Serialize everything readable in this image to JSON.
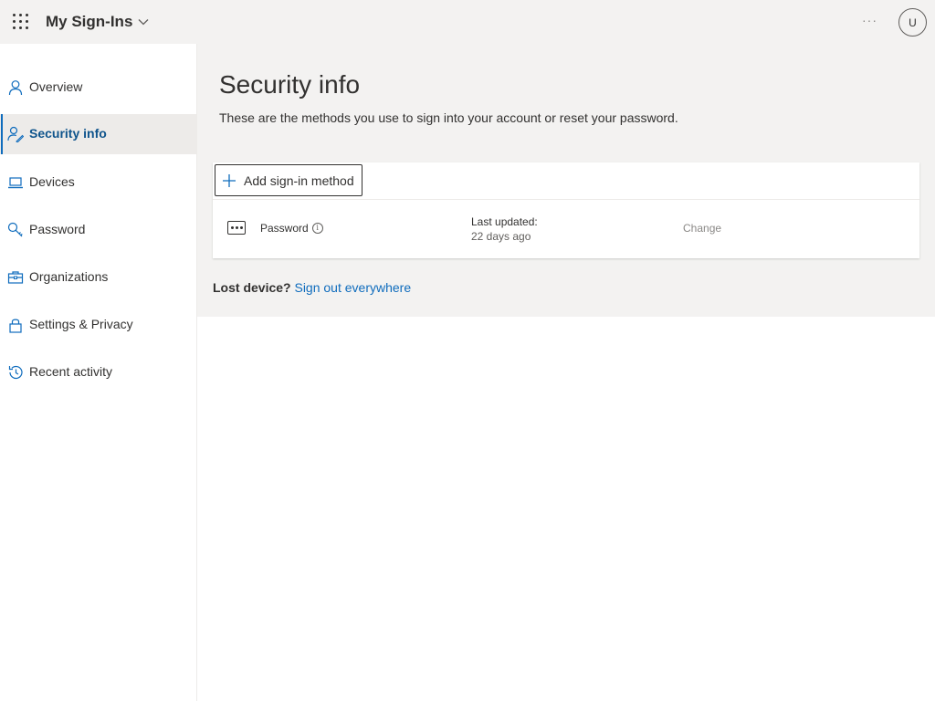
{
  "header": {
    "app_title": "My Sign-Ins",
    "more_label": "···",
    "avatar_initial": "U"
  },
  "sidebar": {
    "items": [
      {
        "label": "Overview",
        "icon": "person-icon"
      },
      {
        "label": "Security info",
        "icon": "person-key-icon",
        "active": true
      },
      {
        "label": "Devices",
        "icon": "laptop-icon"
      },
      {
        "label": "Password",
        "icon": "key-icon"
      },
      {
        "label": "Organizations",
        "icon": "briefcase-icon"
      },
      {
        "label": "Settings & Privacy",
        "icon": "lock-icon"
      },
      {
        "label": "Recent activity",
        "icon": "history-icon"
      }
    ]
  },
  "main": {
    "title": "Security info",
    "subtitle": "These are the methods you use to sign into your account or reset your password.",
    "add_button_label": "Add sign-in method",
    "methods": [
      {
        "name": "Password",
        "updated_label": "Last updated:",
        "updated_value": "22 days ago",
        "action_label": "Change"
      }
    ],
    "lost_device_label": "Lost device?",
    "sign_out_link": "Sign out everywhere"
  },
  "colors": {
    "accent": "#0f6cbd",
    "header_bg": "#f3f2f1",
    "active_nav_bg": "#edebe9"
  }
}
